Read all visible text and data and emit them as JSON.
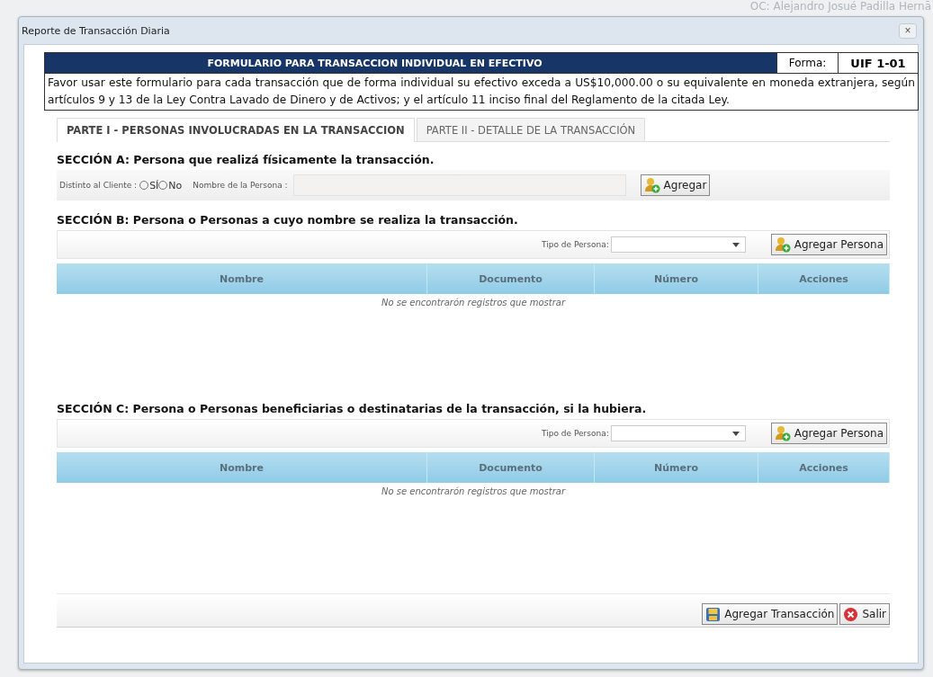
{
  "background": {
    "user_label": "OC: Alejandro Josué Padilla Hernā"
  },
  "dialog": {
    "title": "Reporte de Transacción Diaria",
    "close": "×"
  },
  "form_header": {
    "title": "FORMULARIO PARA TRANSACCION INDIVIDUAL EN EFECTIVO",
    "form_label": "Forma:",
    "form_code": "UIF 1-01",
    "notice": "Favor usar este formulario para cada transacción que de forma individual su efectivo exceda a US$10,000.00 o su equivalente en moneda extranjera, según artículos 9 y 13 de la Ley Contra Lavado de Dinero y de Activos; y el artículo 11 inciso final del Reglamento de la citada Ley."
  },
  "tabs": [
    {
      "label": "PARTE I - PERSONAS INVOLUCRADAS EN LA TRANSACCION",
      "selected": true
    },
    {
      "label": "PARTE II - DETALLE DE LA TRANSACCIÓN",
      "selected": false
    }
  ],
  "section_a": {
    "title": "SECCIÓN A: Persona que realizá físicamente la transacción.",
    "client_label": "Distinto al Cliente :",
    "options": [
      {
        "label": "SÍ",
        "selected": false
      },
      {
        "label": "No",
        "selected": false
      }
    ],
    "name_label": "Nombre de la Persona :",
    "add_button": "Agregar"
  },
  "sections": [
    {
      "title": "SECCIÓN B: Persona o Personas a cuyo nombre se realiza la transacción.",
      "type_label": "Tipo de Persona:",
      "add_button": "Agregar Persona",
      "columns": [
        "Nombre",
        "Documento",
        "Número",
        "Acciones"
      ],
      "empty_message": "No se encontrarón registros que mostrar"
    },
    {
      "title": "SECCIÓN C: Persona o Personas beneficiarias o destinatarias de la transacción, si la hubiera.",
      "type_label": "Tipo de Persona:",
      "add_button": "Agregar Persona",
      "columns": [
        "Nombre",
        "Documento",
        "Número",
        "Acciones"
      ],
      "empty_message": "No se encontrarón registros que mostrar"
    }
  ],
  "footer": {
    "buttons": [
      {
        "kind": "save",
        "label": "Agregar Transacción"
      },
      {
        "kind": "exit",
        "label": "Salir"
      }
    ]
  }
}
